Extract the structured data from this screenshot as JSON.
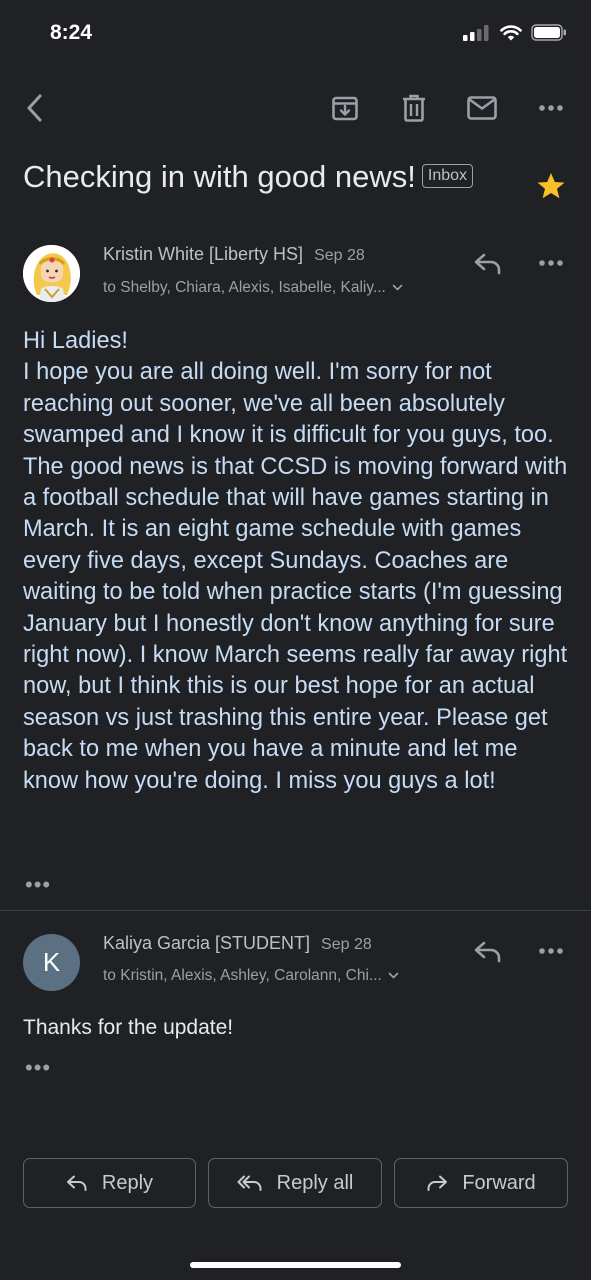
{
  "status_bar": {
    "time": "8:24"
  },
  "toolbar": {
    "back_icon": "chevron-left-icon",
    "archive_icon": "archive-icon",
    "delete_icon": "trash-icon",
    "mark_unread_icon": "envelope-icon",
    "more_icon": "more-horizontal-icon"
  },
  "thread": {
    "subject": "Checking in with good news!",
    "label": "Inbox",
    "starred": true,
    "star_color": "#f6c026"
  },
  "messages": [
    {
      "sender": "Kristin White [Liberty HS]",
      "date": "Sep 28",
      "recipients": "to Shelby, Chiara, Alexis, Isabelle, Kaliy...",
      "body_lines": [
        "Hi Ladies!",
        "I hope you are all doing well.  I'm sorry for not reaching out sooner, we've all been absolutely swamped and I know it is difficult for you guys, too.  The good news is that CCSD is moving forward with a football schedule that will have games starting in March.  It is an eight game schedule with games every five days, except Sundays.  Coaches are waiting to be told when practice starts (I'm guessing January but I honestly don't know anything for sure right now).  I know March seems really far away right now, but I think this is our best hope for an actual season vs just trashing this entire year.  Please get back to me when you have a minute and let me know how you're doing. I miss you guys a lot!"
      ],
      "body_color": "#c6dcf5",
      "collapsed_indicator": "•••"
    },
    {
      "sender": "Kaliya Garcia [STUDENT]",
      "date": "Sep 28",
      "recipients": "to Kristin, Alexis, Ashley, Carolann, Chi...",
      "avatar_letter": "K",
      "avatar_color": "#5b7083",
      "body": "Thanks for the update!",
      "collapsed_indicator": "•••"
    }
  ],
  "actions": {
    "reply": "Reply",
    "reply_all": "Reply all",
    "forward": "Forward"
  }
}
